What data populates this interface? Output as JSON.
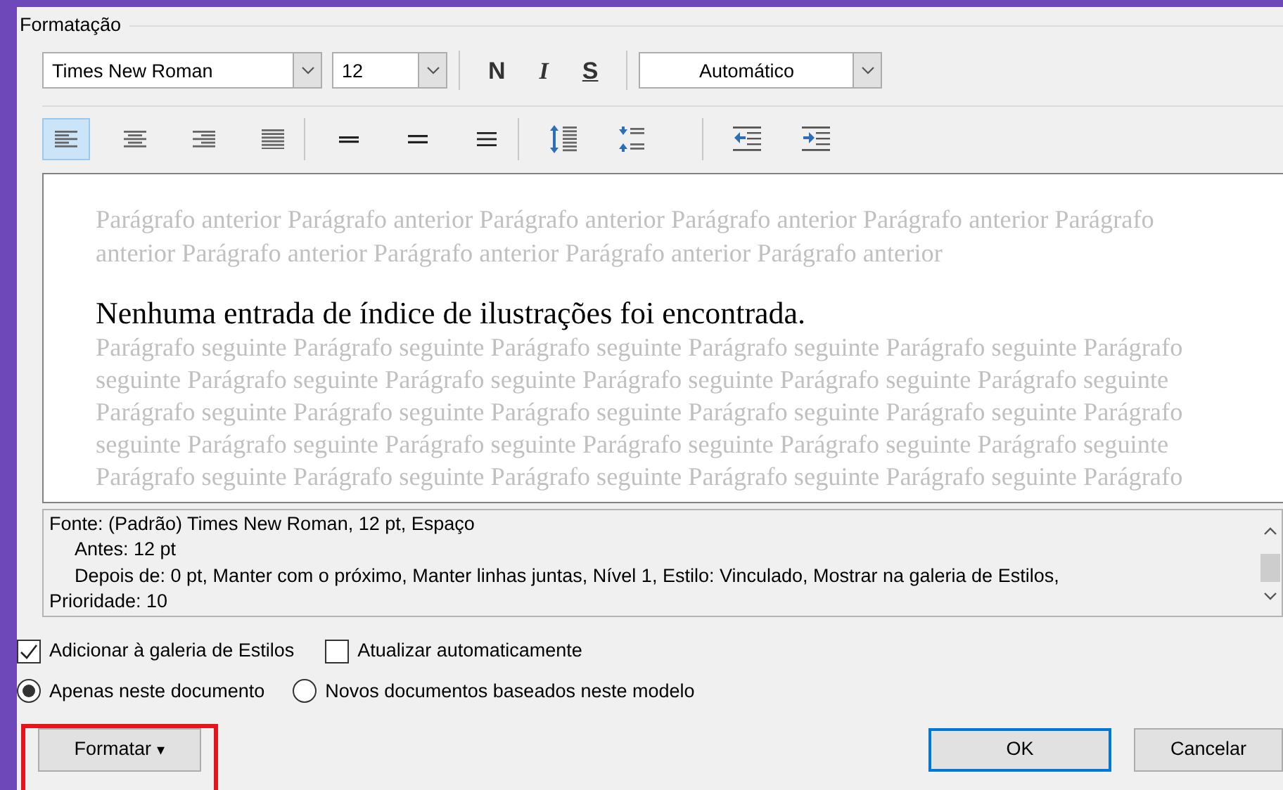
{
  "group_title": "Formatação",
  "font": {
    "name": "Times New Roman",
    "size": "12",
    "color_label": "Automático"
  },
  "style_buttons": [
    {
      "label": "N",
      "kind": "bold"
    },
    {
      "label": "I",
      "kind": "italic"
    },
    {
      "label": "S",
      "kind": "underline"
    }
  ],
  "paragraph_groups": [
    [
      {
        "kind": "align-left",
        "selected": true
      },
      {
        "kind": "align-center",
        "selected": false
      },
      {
        "kind": "align-right",
        "selected": false
      },
      {
        "kind": "justify",
        "selected": false
      }
    ],
    [
      {
        "kind": "spacing-single",
        "selected": false
      },
      {
        "kind": "spacing-onehalf",
        "selected": false
      },
      {
        "kind": "spacing-double",
        "selected": false
      }
    ],
    [
      {
        "kind": "space-increase",
        "selected": false
      },
      {
        "kind": "space-decrease",
        "selected": false
      }
    ],
    [
      {
        "kind": "indent-decrease",
        "selected": false
      },
      {
        "kind": "indent-increase",
        "selected": false
      }
    ]
  ],
  "preview": {
    "before": [
      "Parágrafo anterior Parágrafo anterior Parágrafo anterior Parágrafo anterior Parágrafo anterior Parágrafo",
      "anterior Parágrafo anterior Parágrafo anterior Parágrafo anterior Parágrafo anterior"
    ],
    "main": "Nenhuma entrada de índice de ilustrações foi encontrada.",
    "after": [
      "Parágrafo seguinte Parágrafo seguinte Parágrafo seguinte Parágrafo seguinte Parágrafo seguinte Parágrafo",
      "seguinte Parágrafo seguinte Parágrafo seguinte Parágrafo seguinte Parágrafo seguinte Parágrafo seguinte",
      "Parágrafo seguinte Parágrafo seguinte Parágrafo seguinte Parágrafo seguinte Parágrafo seguinte Parágrafo",
      "seguinte Parágrafo seguinte Parágrafo seguinte Parágrafo seguinte Parágrafo seguinte Parágrafo seguinte",
      "Parágrafo seguinte Parágrafo seguinte Parágrafo seguinte Parágrafo seguinte Parágrafo seguinte Parágrafo"
    ]
  },
  "description": [
    {
      "text": "Fonte: (Padrão) Times New Roman, 12 pt, Espaço",
      "indented": false
    },
    {
      "text": "Antes:  12 pt",
      "indented": true
    },
    {
      "text": "Depois de:  0 pt, Manter com o próximo, Manter linhas juntas, Nível 1, Estilo: Vinculado, Mostrar na galeria de Estilos,",
      "indented": true
    },
    {
      "text": "Prioridade: 10",
      "indented": false
    }
  ],
  "checkboxes": [
    {
      "label": "Adicionar à galeria de Estilos",
      "checked": true
    },
    {
      "label": "Atualizar automaticamente",
      "checked": false
    }
  ],
  "radios": [
    {
      "label": "Apenas neste documento",
      "selected": true
    },
    {
      "label": "Novos documentos baseados neste modelo",
      "selected": false
    }
  ],
  "format_button": {
    "label": "Formatar",
    "caret": "▾",
    "highlighted": true
  },
  "buttons": [
    {
      "label": "OK",
      "default": true
    },
    {
      "label": "Cancelar",
      "default": false
    }
  ]
}
